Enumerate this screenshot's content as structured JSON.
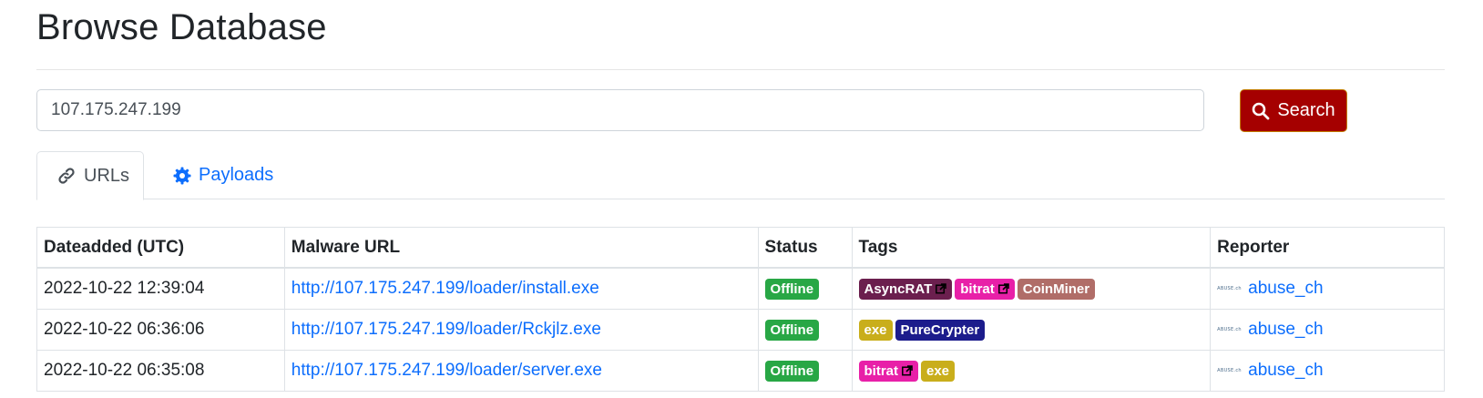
{
  "page": {
    "title": "Browse Database"
  },
  "search": {
    "value": "107.175.247.199",
    "button_label": "Search"
  },
  "tabs": [
    {
      "label": "URLs",
      "icon": "link-icon",
      "active": true
    },
    {
      "label": "Payloads",
      "icon": "gear-icon",
      "active": false
    }
  ],
  "table": {
    "headers": [
      "Dateadded (UTC)",
      "Malware URL",
      "Status",
      "Tags",
      "Reporter"
    ],
    "rows": [
      {
        "date": "2022-10-22 12:39:04",
        "url": "http://107.175.247.199/loader/install.exe",
        "status": "Offline",
        "tags": [
          {
            "label": "AsyncRAT",
            "color": "#6b1f4e",
            "external": true
          },
          {
            "label": "bitrat",
            "color": "#e820a8",
            "external": true
          },
          {
            "label": "CoinMiner",
            "color": "#b06d68",
            "external": false
          }
        ],
        "reporter": "abuse_ch",
        "reporter_logo": "ABUSE.ch"
      },
      {
        "date": "2022-10-22 06:36:06",
        "url": "http://107.175.247.199/loader/Rckjlz.exe",
        "status": "Offline",
        "tags": [
          {
            "label": "exe",
            "color": "#c9ae1b",
            "external": false
          },
          {
            "label": "PureCrypter",
            "color": "#1c1c8c",
            "external": false
          }
        ],
        "reporter": "abuse_ch",
        "reporter_logo": "ABUSE.ch"
      },
      {
        "date": "2022-10-22 06:35:08",
        "url": "http://107.175.247.199/loader/server.exe",
        "status": "Offline",
        "tags": [
          {
            "label": "bitrat",
            "color": "#e820a8",
            "external": true
          },
          {
            "label": "exe",
            "color": "#c9ae1b",
            "external": false
          }
        ],
        "reporter": "abuse_ch",
        "reporter_logo": "ABUSE.ch"
      }
    ]
  },
  "colors": {
    "link": "#0d6efd",
    "search_button": "#a50000",
    "status_offline": "#28a745"
  }
}
